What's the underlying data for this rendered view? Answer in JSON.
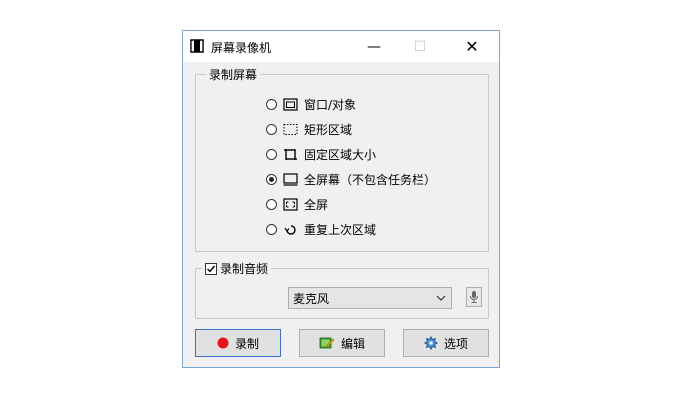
{
  "window": {
    "title": "屏幕录像机",
    "minimize_glyph": "—",
    "maximize_glyph": "☐",
    "close_glyph": "✕"
  },
  "screen_group": {
    "legend": "录制屏幕",
    "options": [
      {
        "label": "窗口/对象",
        "icon": "window-icon",
        "selected": false
      },
      {
        "label": "矩形区域",
        "icon": "dashed-rect-icon",
        "selected": false
      },
      {
        "label": "固定区域大小",
        "icon": "fixed-area-icon",
        "selected": false
      },
      {
        "label": "全屏幕（不包含任务栏）",
        "icon": "monitor-icon",
        "selected": true
      },
      {
        "label": "全屏",
        "icon": "fullscreen-icon",
        "selected": false
      },
      {
        "label": "重复上次区域",
        "icon": "repeat-icon",
        "selected": false
      }
    ]
  },
  "audio_group": {
    "legend": "录制音频",
    "checked": true,
    "device": "麦克风"
  },
  "buttons": {
    "record": "录制",
    "edit": "编辑",
    "options": "选项"
  },
  "colors": {
    "record_dot": "#e8141b",
    "accent_border": "#3a72c4"
  }
}
